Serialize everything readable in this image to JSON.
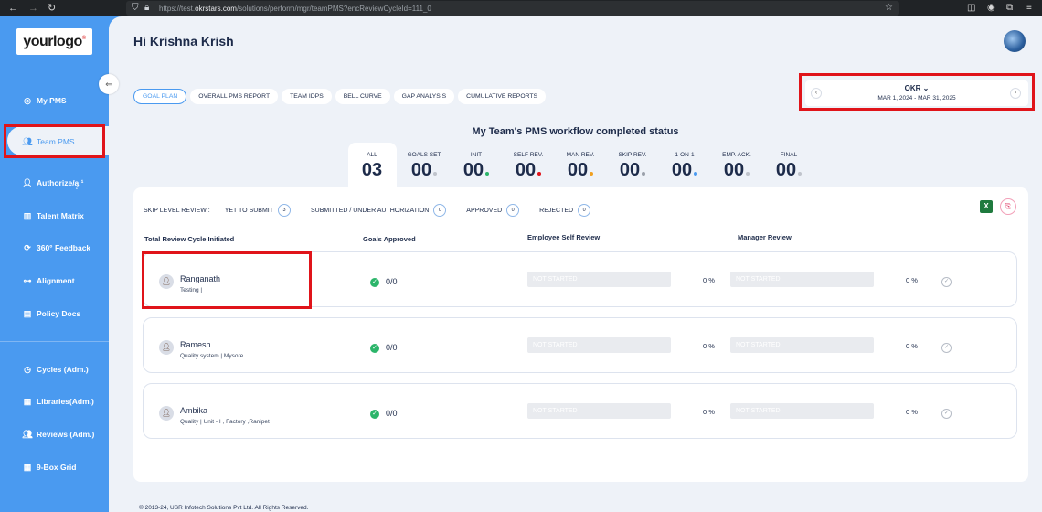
{
  "browser": {
    "url_prefix": "https://test.",
    "url_domain": "okrstars.com",
    "url_path": "/solutions/perform/mgr/teamPMS?encReviewCycleId=111_0"
  },
  "sidebar": {
    "logo_text": "yourlogo",
    "logo_mark": "®",
    "items": [
      {
        "label": "My PMS",
        "icon": "pms-icon"
      },
      {
        "label": "Team PMS",
        "icon": "team-icon"
      },
      {
        "label": "Authorize/ą̥  ¹",
        "icon": "authorize-icon"
      },
      {
        "label": "Talent Matrix",
        "icon": "matrix-icon"
      },
      {
        "label": "360° Feedback",
        "icon": "feedback-icon"
      },
      {
        "label": "Alignment",
        "icon": "alignment-icon"
      },
      {
        "label": "Policy Docs",
        "icon": "docs-icon"
      },
      {
        "label": "Cycles (Adm.)",
        "icon": "cycles-icon"
      },
      {
        "label": "Libraries(Adm.)",
        "icon": "library-icon"
      },
      {
        "label": "Reviews (Adm.)",
        "icon": "reviews-icon"
      },
      {
        "label": "9-Box Grid",
        "icon": "grid-icon"
      }
    ]
  },
  "header": {
    "greeting": "Hi Krishna Krish"
  },
  "tabs": [
    "GOAL PLAN",
    "OVERALL PMS REPORT",
    "TEAM IDPS",
    "BELL CURVE",
    "GAP ANALYSIS",
    "CUMULATIVE REPORTS"
  ],
  "cycle": {
    "type": "OKR",
    "range": "MAR 1, 2024 - MAR 31, 2025"
  },
  "workflow": {
    "title": "My Team's PMS workflow completed status",
    "stats": [
      {
        "label": "ALL",
        "value": "03",
        "color": ""
      },
      {
        "label": "GOALS SET",
        "value": "00",
        "color": "#c0c4cc"
      },
      {
        "label": "INIT",
        "value": "00",
        "color": "#2cb56a"
      },
      {
        "label": "SELF REV.",
        "value": "00",
        "color": "#e0141a"
      },
      {
        "label": "MAN REV.",
        "value": "00",
        "color": "#f0a020"
      },
      {
        "label": "SKIP REV.",
        "value": "00",
        "color": "#9aa0aa"
      },
      {
        "label": "1-ON-1",
        "value": "00",
        "color": "#4a9af0"
      },
      {
        "label": "EMP. ACK.",
        "value": "00",
        "color": "#c0c4cc"
      },
      {
        "label": "FINAL",
        "value": "00",
        "color": "#c0c4cc"
      }
    ]
  },
  "skip_review": {
    "label": "SKIP LEVEL REVIEW :",
    "items": [
      {
        "label": "YET TO SUBMIT",
        "count": "3"
      },
      {
        "label": "SUBMITTED / UNDER AUTHORIZATION",
        "count": "0"
      },
      {
        "label": "APPROVED",
        "count": "0"
      },
      {
        "label": "REJECTED",
        "count": "0"
      }
    ]
  },
  "table": {
    "headers": [
      "Total Review Cycle Initiated",
      "Goals Approved",
      "Employee Self Review",
      "Manager Review"
    ],
    "rows": [
      {
        "name": "Ranganath",
        "sub": "Testing |",
        "goals": "0/0",
        "self_status": "NOT STARTED",
        "self_pct": "0 %",
        "mgr_status": "NOT STARTED",
        "mgr_pct": "0 %"
      },
      {
        "name": "Ramesh",
        "sub": "Quality system | Mysore",
        "goals": "0/0",
        "self_status": "NOT STARTED",
        "self_pct": "0 %",
        "mgr_status": "NOT STARTED",
        "mgr_pct": "0 %"
      },
      {
        "name": "Ambika",
        "sub": "Quality | Unit - I , Factory ,Ranipet",
        "goals": "0/0",
        "self_status": "NOT STARTED",
        "self_pct": "0 %",
        "mgr_status": "NOT STARTED",
        "mgr_pct": "0 %"
      }
    ]
  },
  "footer": {
    "text": "© 2013-24, USR Infotech Solutions Pvt Ltd. All Rights Reserved."
  }
}
